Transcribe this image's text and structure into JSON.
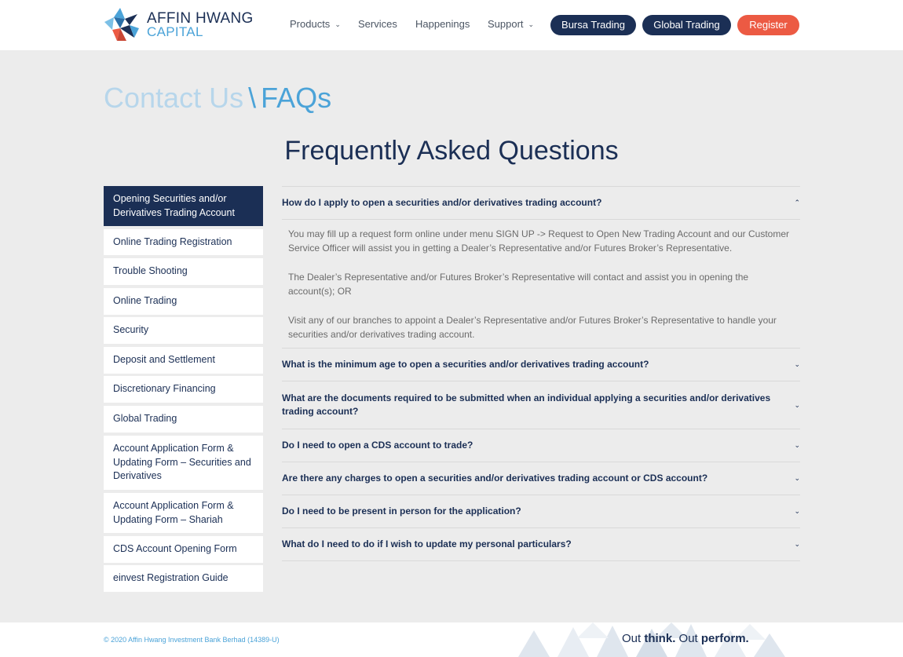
{
  "brand": {
    "name_line1": "AFFIN HWANG",
    "name_line2": "CAPITAL"
  },
  "nav": {
    "products": "Products",
    "services": "Services",
    "happenings": "Happenings",
    "support": "Support",
    "bursa": "Bursa Trading",
    "global": "Global Trading",
    "register": "Register"
  },
  "breadcrumb": {
    "part1": "Contact Us",
    "sep": "\\",
    "part2": "FAQs"
  },
  "page_title": "Frequently Asked Questions",
  "sidebar": {
    "items": [
      {
        "label": "Opening Securities and/or Derivatives Trading Account"
      },
      {
        "label": "Online Trading Registration"
      },
      {
        "label": "Trouble Shooting"
      },
      {
        "label": "Online Trading"
      },
      {
        "label": "Security"
      },
      {
        "label": "Deposit and Settlement"
      },
      {
        "label": "Discretionary Financing"
      },
      {
        "label": "Global Trading"
      },
      {
        "label": "Account Application Form & Updating Form – Securities and Derivatives"
      },
      {
        "label": "Account Application Form & Updating Form – Shariah"
      },
      {
        "label": "CDS Account Opening Form"
      },
      {
        "label": "einvest Registration Guide"
      }
    ]
  },
  "faq": {
    "open_question": "How do I apply to open a securities and/or derivatives trading account?",
    "answer": [
      "You may fill up a request form online under menu SIGN UP -> Request to Open New Trading Account and our Customer Service Officer will assist you in getting a Dealer’s Representative and/or Futures Broker’s Representative.",
      "The Dealer’s Representative and/or Futures Broker’s Representative will contact and assist you in opening the account(s); OR",
      "Visit any of our branches to appoint a Dealer’s Representative and/or Futures Broker’s Representative to handle your securities and/or derivatives trading account."
    ],
    "questions": [
      "What is the minimum age to open a securities and/or derivatives trading account?",
      "What are the documents required to be submitted when an individual applying a securities and/or derivatives trading account?",
      "Do I need to open a CDS account to trade?",
      "Are there any charges to open a securities and/or derivatives trading account or CDS account?",
      "Do I need to be present in person for the application?",
      "What do I need to do if I wish to update my personal particulars?"
    ]
  },
  "footer": {
    "copyright": "© 2020 Affin Hwang Investment Bank Berhad (14389-U)",
    "tag_out1": "Out ",
    "tag_think": "think.",
    "tag_out2": " Out ",
    "tag_perform": "perform."
  },
  "colors": {
    "navy": "#1b2f55",
    "accent_blue": "#4ba3d8",
    "red": "#ec5a43",
    "bg": "#ececec"
  }
}
